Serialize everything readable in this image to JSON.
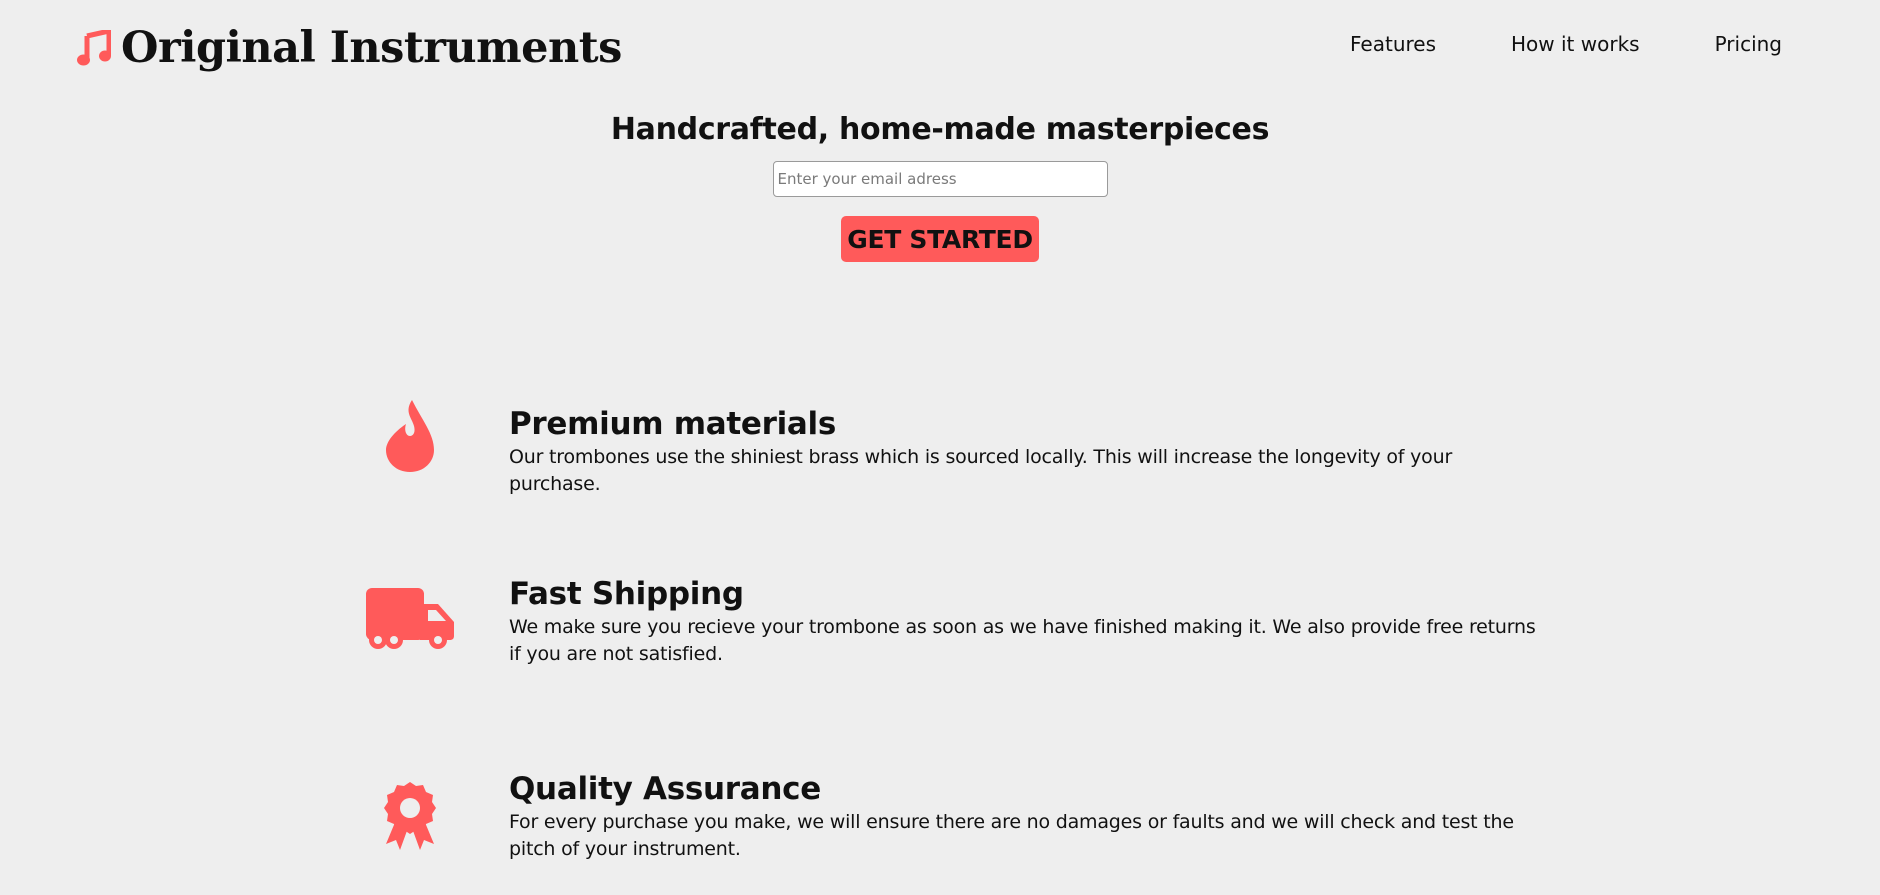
{
  "header": {
    "logo_text": "Original Instruments",
    "logo_icon": "music-note-icon",
    "nav": [
      {
        "label": "Features"
      },
      {
        "label": "How it works"
      },
      {
        "label": "Pricing"
      }
    ]
  },
  "hero": {
    "title": "Handcrafted, home-made masterpieces",
    "email_placeholder": "Enter your email adress",
    "email_value": "",
    "cta_label": "GET STARTED"
  },
  "features": [
    {
      "icon": "fire-icon",
      "title": "Premium materials",
      "description": "Our trombones use the shiniest brass which is sourced locally. This will increase the longevity of your purchase."
    },
    {
      "icon": "truck-icon",
      "title": "Fast Shipping",
      "description": "We make sure you recieve your trombone as soon as we have finished making it. We also provide free returns if you are not satisfied."
    },
    {
      "icon": "award-icon",
      "title": "Quality Assurance",
      "description": "For every purchase you make, we will ensure there are no damages or faults and we will check and test the pitch of your instrument."
    }
  ],
  "colors": {
    "accent": "#ff5a5a",
    "background": "#eeeeee",
    "text": "#111111"
  }
}
